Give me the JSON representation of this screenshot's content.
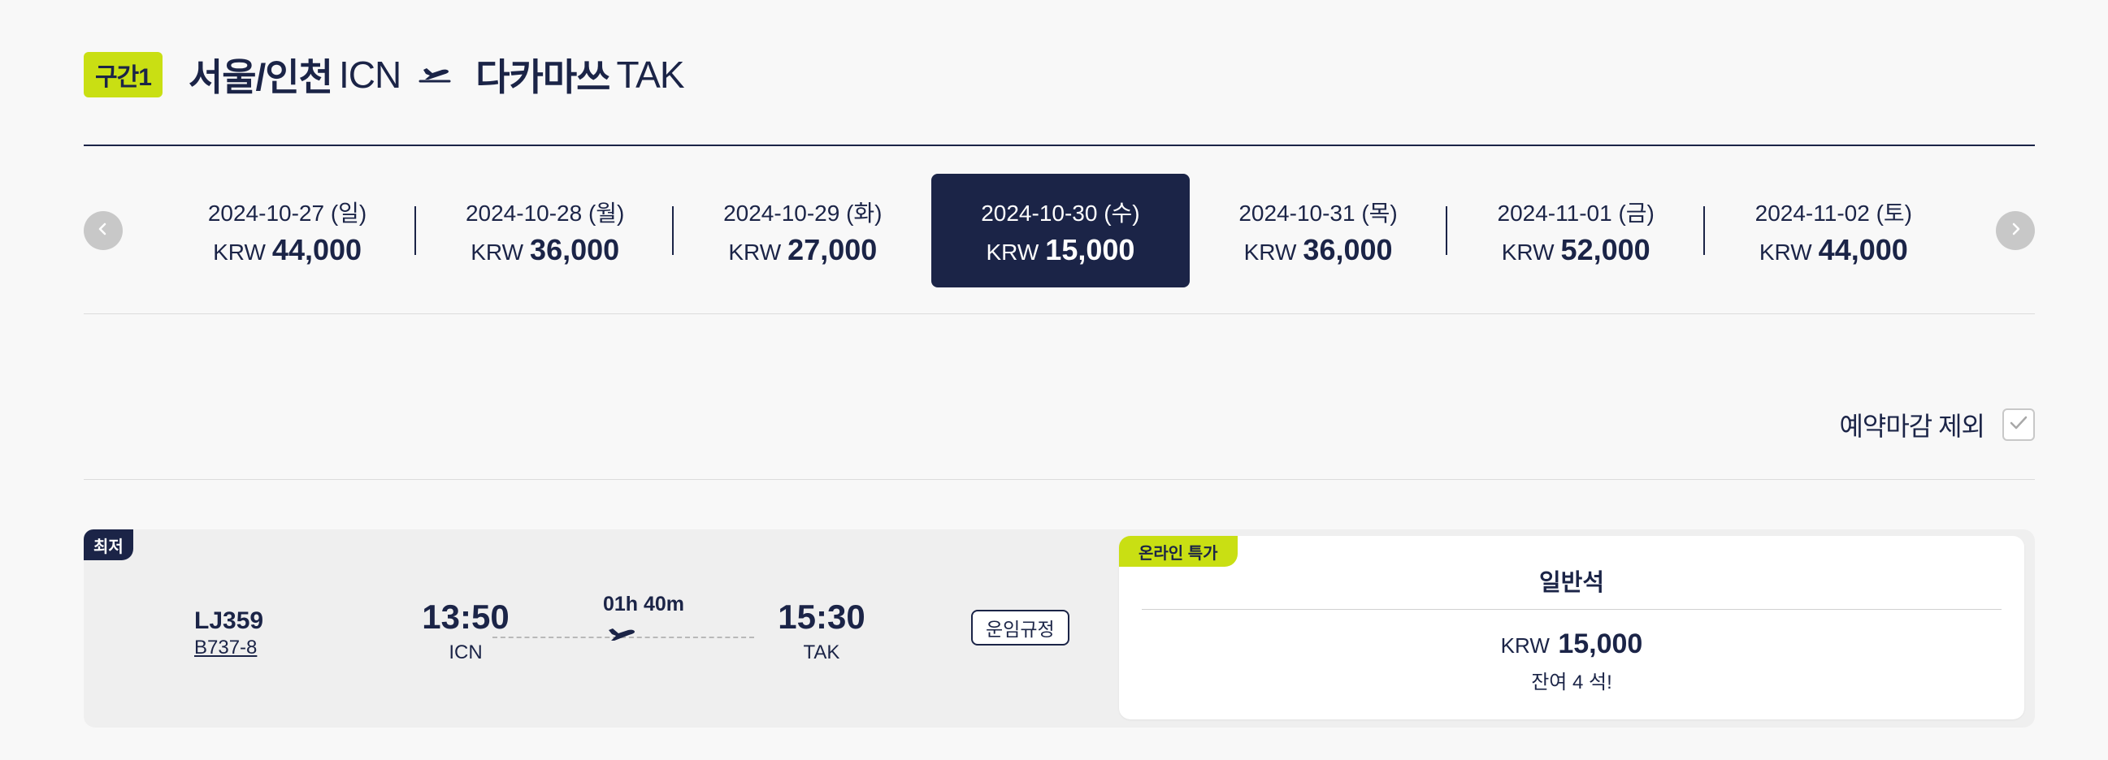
{
  "segment": {
    "badge": "구간1",
    "origin_city": "서울/인천",
    "origin_code": "ICN",
    "dest_city": "다카마쓰",
    "dest_code": "TAK"
  },
  "colors": {
    "navy": "#1b2447",
    "lime": "#c9df13"
  },
  "date_tabs": [
    {
      "date": "2024-10-27 (일)",
      "currency": "KRW",
      "price": "44,000",
      "active": false
    },
    {
      "date": "2024-10-28 (월)",
      "currency": "KRW",
      "price": "36,000",
      "active": false
    },
    {
      "date": "2024-10-29 (화)",
      "currency": "KRW",
      "price": "27,000",
      "active": false
    },
    {
      "date": "2024-10-30 (수)",
      "currency": "KRW",
      "price": "15,000",
      "active": true
    },
    {
      "date": "2024-10-31 (목)",
      "currency": "KRW",
      "price": "36,000",
      "active": false
    },
    {
      "date": "2024-11-01 (금)",
      "currency": "KRW",
      "price": "52,000",
      "active": false
    },
    {
      "date": "2024-11-02 (토)",
      "currency": "KRW",
      "price": "44,000",
      "active": false
    }
  ],
  "nav": {
    "prev_icon": "chevron-left-icon",
    "next_icon": "chevron-right-icon"
  },
  "filter": {
    "label": "예약마감 제외",
    "checked": true
  },
  "flight": {
    "badge": "최저",
    "flight_no": "LJ359",
    "aircraft": "B737-8",
    "dep_time": "13:50",
    "dep_airport": "ICN",
    "duration": "01h 40m",
    "arr_time": "15:30",
    "arr_airport": "TAK",
    "fare_rule_label": "운임규정",
    "fare": {
      "promo": "온라인 특가",
      "class": "일반석",
      "currency": "KRW",
      "price": "15,000",
      "seats": "잔여 4 석!"
    }
  }
}
